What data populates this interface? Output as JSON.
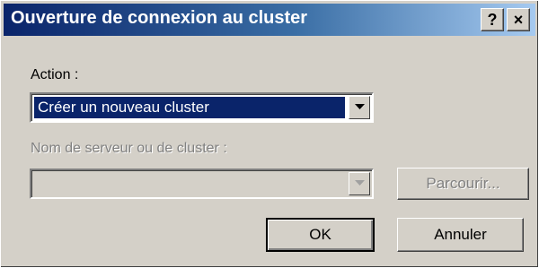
{
  "window": {
    "title": "Ouverture de connexion au cluster",
    "help_glyph": "?",
    "close_glyph": "×"
  },
  "action": {
    "label": "Action :",
    "selected": "Créer un nouveau cluster"
  },
  "server": {
    "label": "Nom de serveur ou de cluster :",
    "value": "",
    "enabled": false
  },
  "buttons": {
    "browse": "Parcourir...",
    "ok": "OK",
    "cancel": "Annuler"
  },
  "colors": {
    "dialog_face": "#d4d0c8",
    "titlebar_start": "#0a246a",
    "titlebar_end": "#a6caf0",
    "selection": "#0a246a"
  }
}
